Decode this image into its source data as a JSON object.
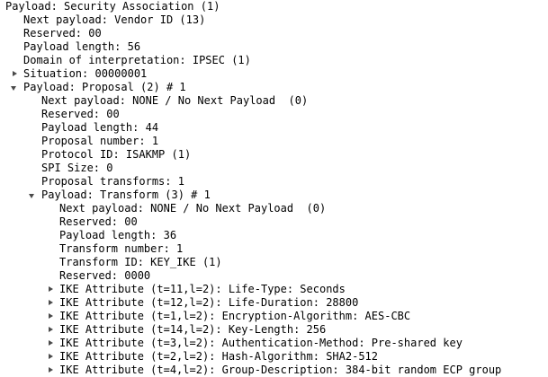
{
  "tree": [
    {
      "level": 0,
      "toggle": "none",
      "text": "Payload: Security Association (1)"
    },
    {
      "level": 1,
      "toggle": "none",
      "text": "Next payload: Vendor ID (13)"
    },
    {
      "level": 1,
      "toggle": "none",
      "text": "Reserved: 00"
    },
    {
      "level": 1,
      "toggle": "none",
      "text": "Payload length: 56"
    },
    {
      "level": 1,
      "toggle": "none",
      "text": "Domain of interpretation: IPSEC (1)"
    },
    {
      "level": 1,
      "toggle": "collapsed",
      "text": "Situation: 00000001"
    },
    {
      "level": 1,
      "toggle": "expanded",
      "text": "Payload: Proposal (2) # 1"
    },
    {
      "level": 2,
      "toggle": "none",
      "text": "Next payload: NONE / No Next Payload  (0)"
    },
    {
      "level": 2,
      "toggle": "none",
      "text": "Reserved: 00"
    },
    {
      "level": 2,
      "toggle": "none",
      "text": "Payload length: 44"
    },
    {
      "level": 2,
      "toggle": "none",
      "text": "Proposal number: 1"
    },
    {
      "level": 2,
      "toggle": "none",
      "text": "Protocol ID: ISAKMP (1)"
    },
    {
      "level": 2,
      "toggle": "none",
      "text": "SPI Size: 0"
    },
    {
      "level": 2,
      "toggle": "none",
      "text": "Proposal transforms: 1"
    },
    {
      "level": 2,
      "toggle": "expanded",
      "text": "Payload: Transform (3) # 1"
    },
    {
      "level": 3,
      "toggle": "none",
      "text": "Next payload: NONE / No Next Payload  (0)"
    },
    {
      "level": 3,
      "toggle": "none",
      "text": "Reserved: 00"
    },
    {
      "level": 3,
      "toggle": "none",
      "text": "Payload length: 36"
    },
    {
      "level": 3,
      "toggle": "none",
      "text": "Transform number: 1"
    },
    {
      "level": 3,
      "toggle": "none",
      "text": "Transform ID: KEY_IKE (1)"
    },
    {
      "level": 3,
      "toggle": "none",
      "text": "Reserved: 0000"
    },
    {
      "level": 3,
      "toggle": "collapsed",
      "text": "IKE Attribute (t=11,l=2): Life-Type: Seconds"
    },
    {
      "level": 3,
      "toggle": "collapsed",
      "text": "IKE Attribute (t=12,l=2): Life-Duration: 28800"
    },
    {
      "level": 3,
      "toggle": "collapsed",
      "text": "IKE Attribute (t=1,l=2): Encryption-Algorithm: AES-CBC"
    },
    {
      "level": 3,
      "toggle": "collapsed",
      "text": "IKE Attribute (t=14,l=2): Key-Length: 256"
    },
    {
      "level": 3,
      "toggle": "collapsed",
      "text": "IKE Attribute (t=3,l=2): Authentication-Method: Pre-shared key"
    },
    {
      "level": 3,
      "toggle": "collapsed",
      "text": "IKE Attribute (t=2,l=2): Hash-Algorithm: SHA2-512"
    },
    {
      "level": 3,
      "toggle": "collapsed",
      "text": "IKE Attribute (t=4,l=2): Group-Description: 384-bit random ECP group"
    }
  ]
}
